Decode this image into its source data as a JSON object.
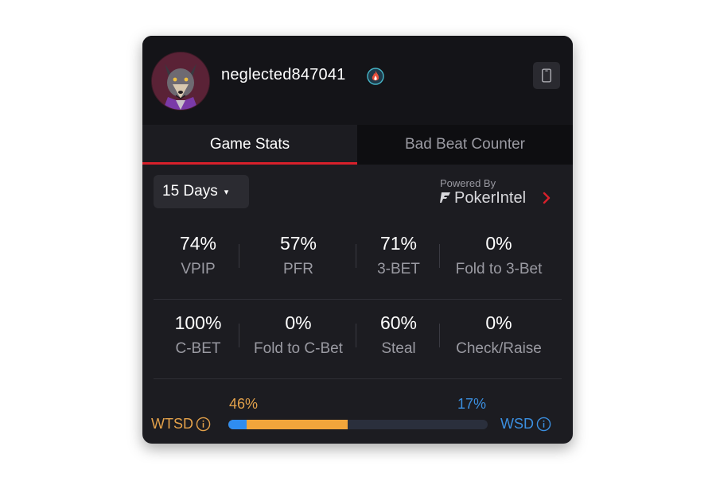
{
  "profile": {
    "username": "neglected847041",
    "avatar_icon": "wolf-avatar",
    "badge_icon": "flame-badge-icon",
    "device_icon": "phone-icon"
  },
  "tabs": [
    {
      "label": "Game Stats",
      "active": true
    },
    {
      "label": "Bad Beat Counter",
      "active": false
    }
  ],
  "period": {
    "label": "15 Days",
    "caret": "▾"
  },
  "powered": {
    "caption": "Powered By",
    "brand": "PokerIntel"
  },
  "stats_row1": [
    {
      "value": "74%",
      "label": "VPIP"
    },
    {
      "value": "57%",
      "label": "PFR"
    },
    {
      "value": "71%",
      "label": "3-BET"
    },
    {
      "value": "0%",
      "label": "Fold to 3-Bet"
    }
  ],
  "stats_row2": [
    {
      "value": "100%",
      "label": "C-BET"
    },
    {
      "value": "0%",
      "label": "Fold to C-Bet"
    },
    {
      "value": "60%",
      "label": "Steal"
    },
    {
      "value": "0%",
      "label": "Check/Raise"
    }
  ],
  "showdown": {
    "wtsd_label": "WTSD",
    "wtsd_value": "46%",
    "wtsd_fraction": 0.46,
    "wsd_label": "WSD",
    "wsd_value": "17%",
    "wsd_fraction": 0.07
  },
  "colors": {
    "accent_red": "#d8202b",
    "wtsd_orange": "#f1a53b",
    "wsd_blue": "#2f8df0"
  }
}
